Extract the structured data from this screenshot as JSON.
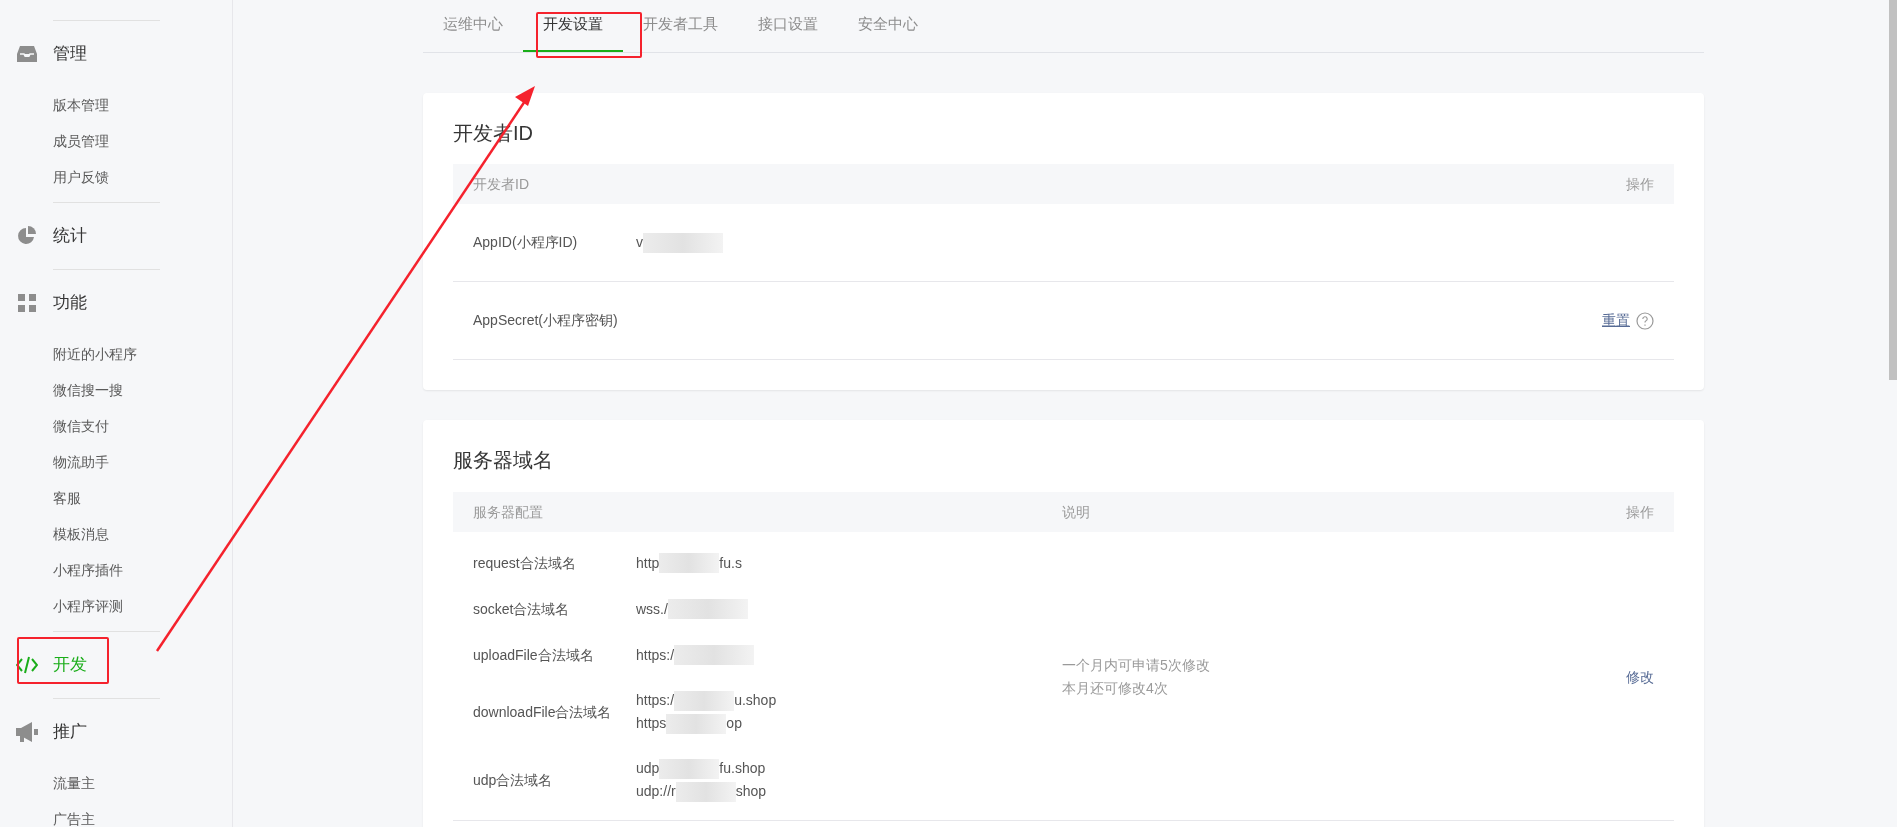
{
  "sidebar": {
    "sections": [
      {
        "label": "管理",
        "selected": false,
        "children": [
          {
            "label": "版本管理",
            "selected": false
          },
          {
            "label": "成员管理",
            "selected": false
          },
          {
            "label": "用户反馈",
            "selected": false
          }
        ]
      },
      {
        "label": "统计",
        "selected": false
      },
      {
        "label": "功能",
        "selected": false,
        "children": [
          {
            "label": "附近的小程序",
            "selected": false
          },
          {
            "label": "微信搜一搜",
            "selected": false
          },
          {
            "label": "微信支付",
            "selected": false
          },
          {
            "label": "物流助手",
            "selected": false
          },
          {
            "label": "客服",
            "selected": false
          },
          {
            "label": "模板消息",
            "selected": false
          },
          {
            "label": "小程序插件",
            "selected": false
          },
          {
            "label": "小程序评测",
            "selected": false
          }
        ]
      },
      {
        "label": "开发",
        "selected": true
      },
      {
        "label": "推广",
        "selected": false,
        "children": [
          {
            "label": "流量主",
            "selected": false
          },
          {
            "label": "广告主",
            "selected": false
          }
        ]
      }
    ]
  },
  "tabs": [
    {
      "label": "运维中心",
      "selected": false
    },
    {
      "label": "开发设置",
      "selected": true
    },
    {
      "label": "开发者工具",
      "selected": false
    },
    {
      "label": "接口设置",
      "selected": false
    },
    {
      "label": "安全中心",
      "selected": false
    }
  ],
  "developer_id": {
    "title": "开发者ID",
    "columns": [
      "开发者ID",
      "操作"
    ],
    "rows": [
      {
        "label": "AppID(小程序ID)",
        "value": {
          "prefix": "v"
        }
      },
      {
        "label": "AppSecret(小程序密钥)",
        "action": "重置"
      }
    ]
  },
  "server_domains": {
    "title": "服务器域名",
    "columns": [
      "服务器配置",
      "说明",
      "操作"
    ],
    "rows": [
      {
        "label": "request合法域名",
        "values": [
          {
            "prefix": "http",
            "suffix": "fu.s"
          }
        ]
      },
      {
        "label": "socket合法域名",
        "values": [
          {
            "prefix": "wss./"
          }
        ]
      },
      {
        "label": "uploadFile合法域名",
        "values": [
          {
            "prefix": "https:/"
          }
        ]
      },
      {
        "label": "downloadFile合法域名",
        "values": [
          {
            "prefix": "https:/",
            "suffix": "u.shop"
          },
          {
            "prefix": "https",
            "suffix": "op"
          }
        ]
      },
      {
        "label": "udp合法域名",
        "values": [
          {
            "prefix": "udp",
            "suffix": "fu.shop"
          },
          {
            "prefix": "udp://r",
            "suffix": "shop"
          }
        ]
      }
    ],
    "note": [
      "一个月内可申请5次修改",
      "本月还可修改4次"
    ],
    "action": "修改"
  }
}
